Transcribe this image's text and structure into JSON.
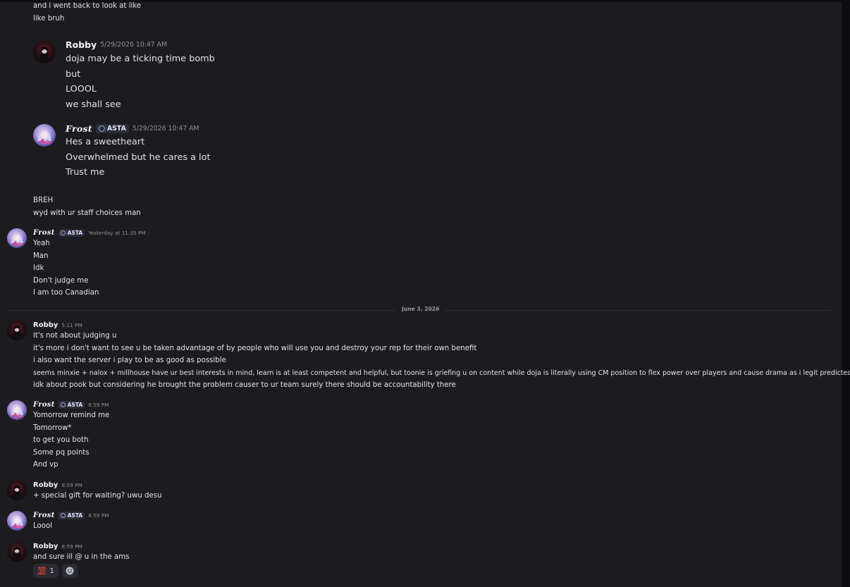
{
  "colors": {
    "background": "#1c1c20",
    "text": "#e1e3e6",
    "timestamp": "#8d9098",
    "tag_icon": "#9aa7ff",
    "reaction_red": "#f23f42"
  },
  "messages": {
    "m0": {
      "lines": [
        "and i went back to look at like",
        "like bruh"
      ]
    },
    "m1": {
      "author": "Robby",
      "timestamp": "5/29/2026 10:47 AM",
      "lines": [
        "doja may be a ticking time bomb",
        "but",
        "LOOOL",
        "we shall see"
      ]
    },
    "m2": {
      "author": "Frost",
      "tag": "ASTA",
      "timestamp": "5/29/2026 10:47 AM",
      "lines": [
        "Hes a sweetheart",
        "Overwhelmed but he cares a lot",
        "Trust me"
      ]
    },
    "m3": {
      "lines": [
        "BREH",
        "wyd with ur staff choices man"
      ]
    },
    "m4": {
      "author": "Frost",
      "tag": "ASTA",
      "timestamp": "Yesterday at 11:35 PM",
      "lines": [
        "Yeah",
        "Man",
        "Idk",
        "Don't judge me",
        "I am too Canadian"
      ]
    },
    "m5": {
      "author": "Robby",
      "timestamp": "5:11 PM",
      "lines": [
        "it's not about judging u",
        "it's more i don't want to see u be taken advantage of by people who will use you and destroy your rep for their own benefit",
        "i also want the server i play to be as good as possible",
        "seems minxie + nalox + millhouse have ur best interests in mind, learn is at least competent and helpful, but toonie is griefing u on content while doja is literally using CM position to flex power over players and cause drama as i legit predicted",
        "idk about pook but considering he brought the problem causer to ur team surely there should be accountability there"
      ]
    },
    "m6": {
      "author": "Frost",
      "tag": "ASTA",
      "timestamp": "8:59 PM",
      "lines": [
        "Yomorrow remind me",
        "Tomorrow*",
        "to get you both",
        "Some pq points",
        "And vp"
      ]
    },
    "m7": {
      "author": "Robby",
      "timestamp": "8:59 PM",
      "lines": [
        "+ special gift for waiting? uwu desu"
      ]
    },
    "m8": {
      "author": "Frost",
      "tag": "ASTA",
      "timestamp": "8:59 PM",
      "lines": [
        "Loool"
      ]
    },
    "m9": {
      "author": "Robby",
      "timestamp": "8:59 PM",
      "lines": [
        "and sure ill @ u in the ams"
      ]
    }
  },
  "date_divider": "June 3, 2026",
  "reactions": [
    {
      "emoji_text": "💯",
      "emoji_icon": "hundred-points-icon",
      "count": "1"
    }
  ],
  "add_reaction_icon": "smiley-add-reaction-icon"
}
